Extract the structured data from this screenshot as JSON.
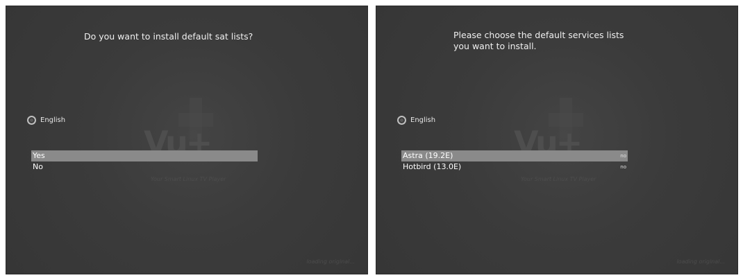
{
  "screens": [
    {
      "question": "Do you want to install default sat lists?",
      "language": "English",
      "items": [
        {
          "label": "Yes",
          "value": ""
        },
        {
          "label": "No",
          "value": ""
        }
      ]
    },
    {
      "question": "Please choose the default services lists\nyou want to install.",
      "language": "English",
      "items": [
        {
          "label": "Astra (19.2E)",
          "value": "no"
        },
        {
          "label": "Hotbird (13.0E)",
          "value": "no"
        }
      ]
    }
  ],
  "branding": {
    "logo": "Vu+",
    "tagline": "Your Smart Linux TV Player",
    "status": "loading original..."
  },
  "colors": {
    "background": "#3b3b3b",
    "selection": "#8a8a8a",
    "text": "#ffffff"
  },
  "icons": [
    "radio-icon"
  ]
}
